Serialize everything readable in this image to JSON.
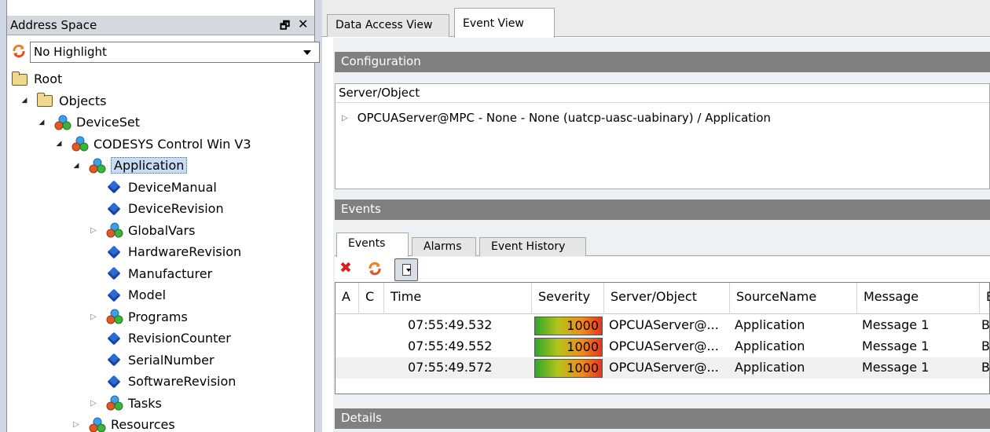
{
  "left_pane": {
    "title": "Address Space",
    "float_glyph": "🗗",
    "close_glyph": "✕",
    "highlight": {
      "selected": "No Highlight"
    },
    "tree": [
      {
        "label": "Root",
        "icon": "folder-icon",
        "level": 0,
        "expander": ""
      },
      {
        "label": "Objects",
        "icon": "folder-icon",
        "level": 1,
        "expander": "open"
      },
      {
        "label": "DeviceSet",
        "icon": "object-icon",
        "level": 2,
        "expander": "open"
      },
      {
        "label": "CODESYS Control Win V3",
        "icon": "object-icon",
        "level": 3,
        "expander": "open"
      },
      {
        "label": "Application",
        "icon": "object-icon",
        "level": 4,
        "expander": "open",
        "selected": true
      },
      {
        "label": "DeviceManual",
        "icon": "variable-icon",
        "level": 5,
        "expander": ""
      },
      {
        "label": "DeviceRevision",
        "icon": "variable-icon",
        "level": 5,
        "expander": ""
      },
      {
        "label": "GlobalVars",
        "icon": "object-icon",
        "level": 5,
        "expander": "closed"
      },
      {
        "label": "HardwareRevision",
        "icon": "variable-icon",
        "level": 5,
        "expander": ""
      },
      {
        "label": "Manufacturer",
        "icon": "variable-icon",
        "level": 5,
        "expander": ""
      },
      {
        "label": "Model",
        "icon": "variable-icon",
        "level": 5,
        "expander": ""
      },
      {
        "label": "Programs",
        "icon": "object-icon",
        "level": 5,
        "expander": "closed"
      },
      {
        "label": "RevisionCounter",
        "icon": "variable-icon",
        "level": 5,
        "expander": ""
      },
      {
        "label": "SerialNumber",
        "icon": "variable-icon",
        "level": 5,
        "expander": ""
      },
      {
        "label": "SoftwareRevision",
        "icon": "variable-icon",
        "level": 5,
        "expander": ""
      },
      {
        "label": "Tasks",
        "icon": "object-icon",
        "level": 5,
        "expander": "closed"
      },
      {
        "label": "Resources",
        "icon": "object-icon",
        "level": 4,
        "expander": "closed"
      }
    ]
  },
  "tabs": [
    {
      "label": "Data Access View",
      "active": false
    },
    {
      "label": "Event View",
      "active": true
    }
  ],
  "configuration": {
    "title": "Configuration",
    "column_header": "Server/Object",
    "row": "OPCUAServer@MPC - None - None (uatcp-uasc-uabinary) / Application"
  },
  "events": {
    "title": "Events",
    "tabs": [
      {
        "label": "Events",
        "active": true
      },
      {
        "label": "Alarms",
        "active": false
      },
      {
        "label": "Event History",
        "active": false
      }
    ],
    "columns": [
      "A",
      "C",
      "Time",
      "Severity",
      "Server/Object",
      "SourceName",
      "Message",
      "B"
    ],
    "rows": [
      {
        "time": "07:55:49.532",
        "severity": "1000",
        "server": "OPCUAServer@...",
        "source": "Application",
        "message": "Message 1",
        "extra": "B"
      },
      {
        "time": "07:55:49.552",
        "severity": "1000",
        "server": "OPCUAServer@...",
        "source": "Application",
        "message": "Message 1",
        "extra": "B"
      },
      {
        "time": "07:55:49.572",
        "severity": "1000",
        "server": "OPCUAServer@...",
        "source": "Application",
        "message": "Message 1",
        "extra": "B"
      }
    ]
  },
  "details": {
    "title": "Details"
  }
}
